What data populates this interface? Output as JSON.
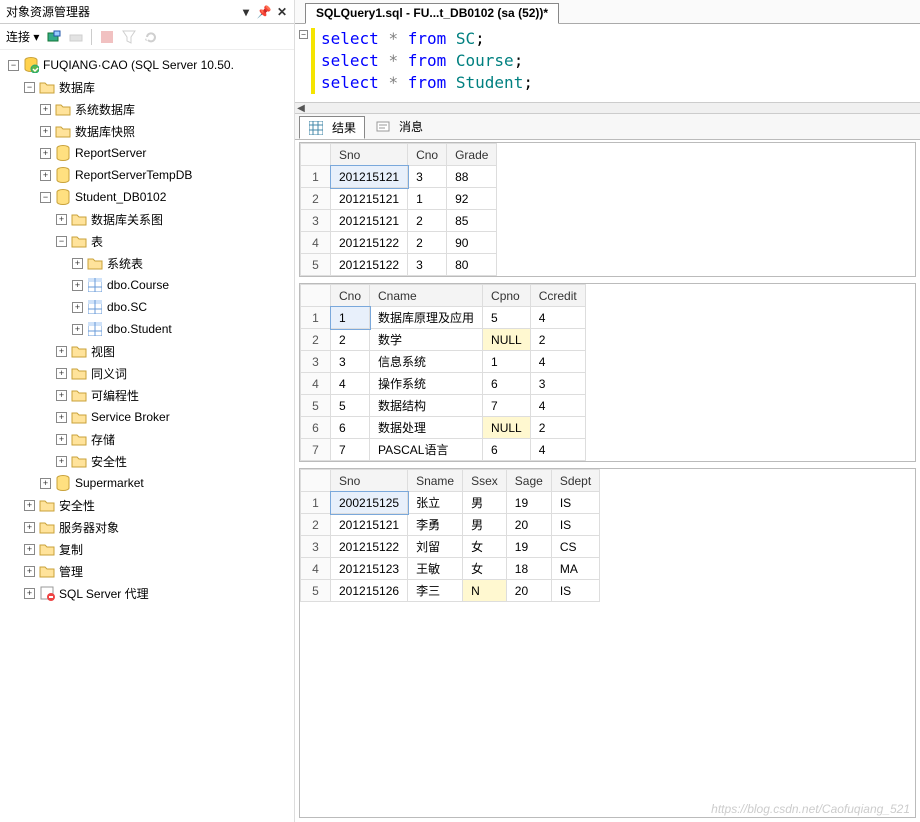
{
  "panel": {
    "title": "对象资源管理器",
    "connect_label": "连接 ▾"
  },
  "tree": [
    {
      "indent": 0,
      "exp": "-",
      "icon": "server",
      "label": "FUQIANG·CAO (SQL Server 10.50."
    },
    {
      "indent": 1,
      "exp": "-",
      "icon": "folder",
      "label": "数据库"
    },
    {
      "indent": 2,
      "exp": "+",
      "icon": "folder",
      "label": "系统数据库"
    },
    {
      "indent": 2,
      "exp": "+",
      "icon": "folder",
      "label": "数据库快照"
    },
    {
      "indent": 2,
      "exp": "+",
      "icon": "db",
      "label": "ReportServer"
    },
    {
      "indent": 2,
      "exp": "+",
      "icon": "db",
      "label": "ReportServerTempDB"
    },
    {
      "indent": 2,
      "exp": "-",
      "icon": "db",
      "label": "Student_DB0102"
    },
    {
      "indent": 3,
      "exp": "+",
      "icon": "folder",
      "label": "数据库关系图"
    },
    {
      "indent": 3,
      "exp": "-",
      "icon": "folder",
      "label": "表"
    },
    {
      "indent": 4,
      "exp": "+",
      "icon": "folder",
      "label": "系统表"
    },
    {
      "indent": 4,
      "exp": "+",
      "icon": "table",
      "label": "dbo.Course"
    },
    {
      "indent": 4,
      "exp": "+",
      "icon": "table",
      "label": "dbo.SC"
    },
    {
      "indent": 4,
      "exp": "+",
      "icon": "table",
      "label": "dbo.Student"
    },
    {
      "indent": 3,
      "exp": "+",
      "icon": "folder",
      "label": "视图"
    },
    {
      "indent": 3,
      "exp": "+",
      "icon": "folder",
      "label": "同义词"
    },
    {
      "indent": 3,
      "exp": "+",
      "icon": "folder",
      "label": "可编程性"
    },
    {
      "indent": 3,
      "exp": "+",
      "icon": "folder",
      "label": "Service Broker"
    },
    {
      "indent": 3,
      "exp": "+",
      "icon": "folder",
      "label": "存储"
    },
    {
      "indent": 3,
      "exp": "+",
      "icon": "folder",
      "label": "安全性"
    },
    {
      "indent": 2,
      "exp": "+",
      "icon": "db",
      "label": "Supermarket"
    },
    {
      "indent": 1,
      "exp": "+",
      "icon": "folder",
      "label": "安全性"
    },
    {
      "indent": 1,
      "exp": "+",
      "icon": "folder",
      "label": "服务器对象"
    },
    {
      "indent": 1,
      "exp": "+",
      "icon": "folder",
      "label": "复制"
    },
    {
      "indent": 1,
      "exp": "+",
      "icon": "folder",
      "label": "管理"
    },
    {
      "indent": 1,
      "exp": "+",
      "icon": "agent",
      "label": "SQL Server 代理"
    }
  ],
  "tab_title": "SQLQuery1.sql - FU...t_DB0102 (sa (52))*",
  "sql_lines": [
    [
      {
        "t": "select",
        "c": "kw"
      },
      {
        "t": " ",
        "c": ""
      },
      {
        "t": "*",
        "c": "op"
      },
      {
        "t": " ",
        "c": ""
      },
      {
        "t": "from",
        "c": "kw"
      },
      {
        "t": " ",
        "c": ""
      },
      {
        "t": "SC",
        "c": "ident"
      },
      {
        "t": ";",
        "c": "punc"
      }
    ],
    [
      {
        "t": "select",
        "c": "kw"
      },
      {
        "t": " ",
        "c": ""
      },
      {
        "t": "*",
        "c": "op"
      },
      {
        "t": " ",
        "c": ""
      },
      {
        "t": "from",
        "c": "kw"
      },
      {
        "t": " ",
        "c": ""
      },
      {
        "t": "Course",
        "c": "ident"
      },
      {
        "t": ";",
        "c": "punc"
      }
    ],
    [
      {
        "t": "select",
        "c": "kw"
      },
      {
        "t": " ",
        "c": ""
      },
      {
        "t": "*",
        "c": "op"
      },
      {
        "t": " ",
        "c": ""
      },
      {
        "t": "from",
        "c": "kw"
      },
      {
        "t": " ",
        "c": ""
      },
      {
        "t": "Student",
        "c": "ident"
      },
      {
        "t": ";",
        "c": "punc"
      }
    ]
  ],
  "results_tabs": {
    "results": "结果",
    "messages": "消息"
  },
  "grid1": {
    "cols": [
      "Sno",
      "Cno",
      "Grade"
    ],
    "rows": [
      [
        "201215121",
        "3",
        "88"
      ],
      [
        "201215121",
        "1",
        "92"
      ],
      [
        "201215121",
        "2",
        "85"
      ],
      [
        "201215122",
        "2",
        "90"
      ],
      [
        "201215122",
        "3",
        "80"
      ]
    ],
    "selected_cell": [
      0,
      0
    ]
  },
  "grid2": {
    "cols": [
      "Cno",
      "Cname",
      "Cpno",
      "Ccredit"
    ],
    "rows": [
      [
        "1",
        "数据库原理及应用",
        "5",
        "4"
      ],
      [
        "2",
        "数学",
        "NULL",
        "2"
      ],
      [
        "3",
        "信息系统",
        "1",
        "4"
      ],
      [
        "4",
        "操作系统",
        "6",
        "3"
      ],
      [
        "5",
        "数据结构",
        "7",
        "4"
      ],
      [
        "6",
        "数据处理",
        "NULL",
        "2"
      ],
      [
        "7",
        "PASCAL语言",
        "6",
        "4"
      ]
    ],
    "selected_cell": [
      0,
      0
    ],
    "null_cells": [
      [
        1,
        2
      ],
      [
        5,
        2
      ]
    ]
  },
  "grid3": {
    "cols": [
      "Sno",
      "Sname",
      "Ssex",
      "Sage",
      "Sdept"
    ],
    "rows": [
      [
        "200215125",
        "张立",
        "男",
        "19",
        "IS"
      ],
      [
        "201215121",
        "李勇",
        "男",
        "20",
        "IS"
      ],
      [
        "201215122",
        "刘留",
        "女",
        "19",
        "CS"
      ],
      [
        "201215123",
        "王敏",
        "女",
        "18",
        "MA"
      ],
      [
        "201215126",
        "李三",
        "N",
        "20",
        "IS"
      ]
    ],
    "selected_cell": [
      0,
      0
    ],
    "null_cells": [
      [
        4,
        2
      ]
    ]
  },
  "watermark": "https://blog.csdn.net/Caofuqiang_521"
}
